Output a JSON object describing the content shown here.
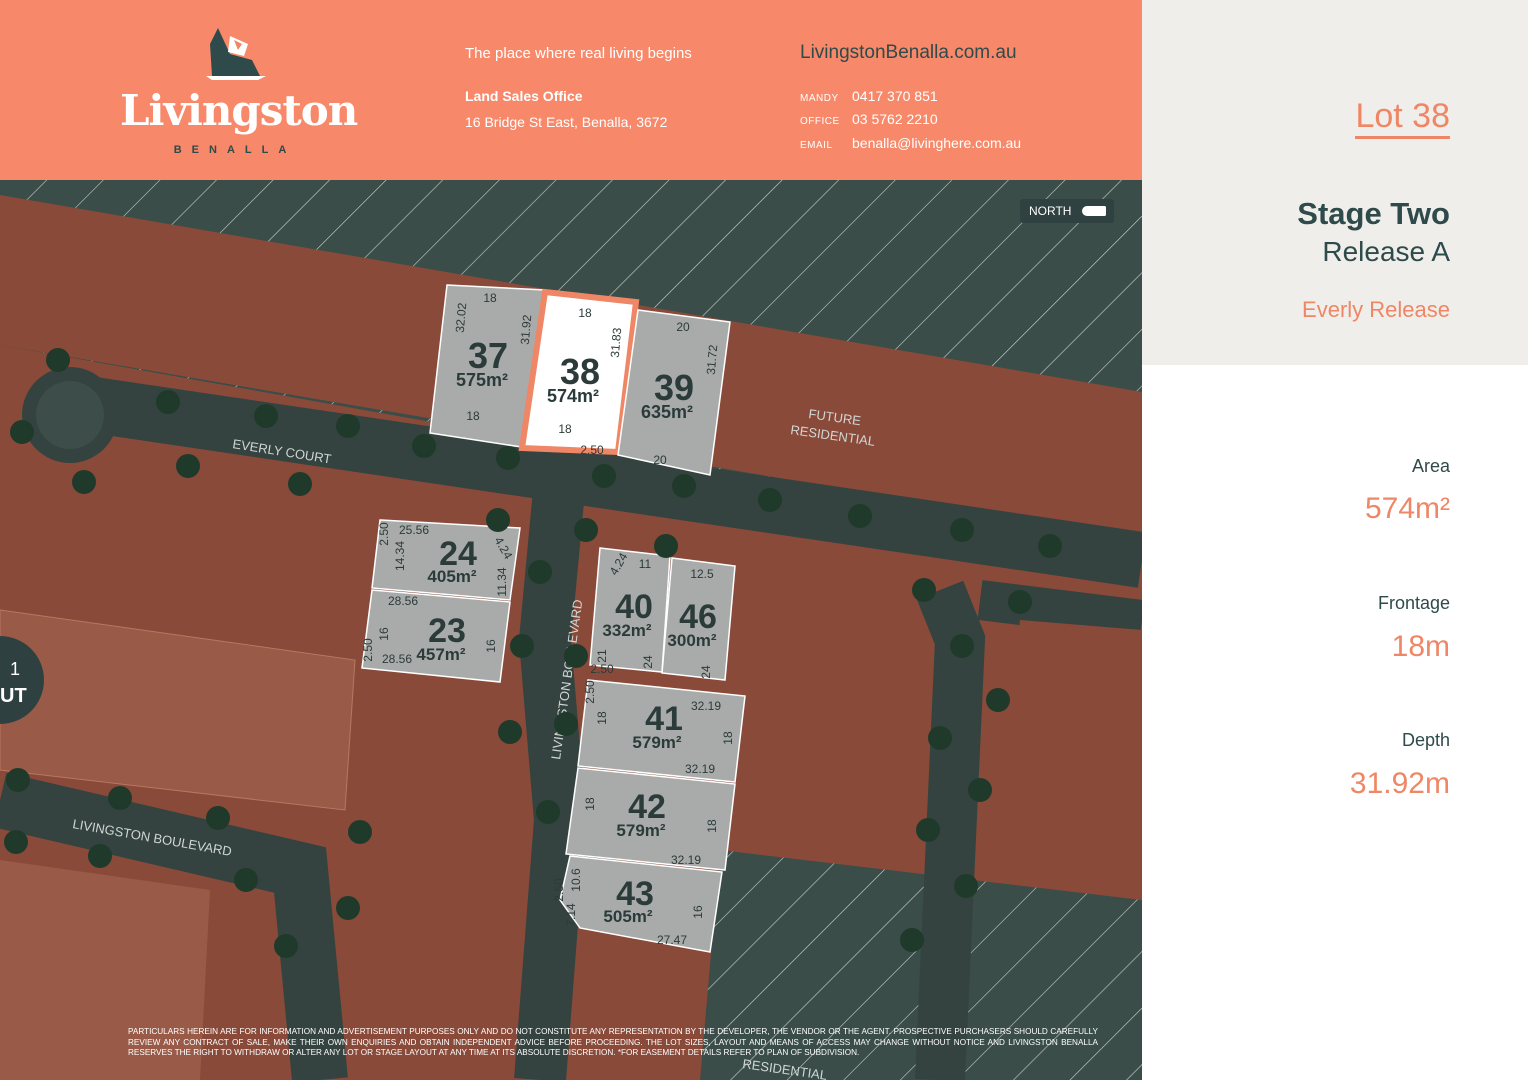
{
  "header": {
    "brand": "Livingston",
    "brand_sub": "BENALLA",
    "tagline": "The place where real living begins",
    "office_title": "Land Sales Office",
    "office_address": "16 Bridge St East, Benalla, 3672",
    "website": "LivingstonBenalla.com.au",
    "contacts": [
      {
        "key": "MANDY",
        "value": "0417 370 851"
      },
      {
        "key": "OFFICE",
        "value": "03 5762 2210"
      },
      {
        "key": "EMAIL",
        "value": "benalla@livinghere.com.au"
      }
    ],
    "colors": {
      "header_bg": "#f7896a",
      "accent": "#ef8665",
      "dark": "#2e4a4a"
    }
  },
  "map": {
    "north_label": "NORTH",
    "future_residential": [
      "FUTURE",
      "RESIDENTIAL"
    ],
    "bottom_residential": "RESIDENTIAL",
    "roads": {
      "everly": "EVERLY COURT",
      "livingston_v": "LIVINGSTON BOULEVARD",
      "livingston_h": "LIVINGSTON BOULEVARD"
    },
    "side_badge": [
      "1",
      "UT"
    ],
    "lots": [
      {
        "num": "37",
        "area": "575m²",
        "dims": [
          "18",
          "32.02",
          "31.92",
          "18"
        ]
      },
      {
        "num": "38",
        "area": "574m²",
        "dims": [
          "18",
          "31.83",
          "18",
          "2.50"
        ],
        "selected": true
      },
      {
        "num": "39",
        "area": "635m²",
        "dims": [
          "20",
          "31.72",
          "20"
        ]
      },
      {
        "num": "24",
        "area": "405m²",
        "dims": [
          "25.56",
          "2.50",
          "14.34",
          "4.24",
          "11.34"
        ]
      },
      {
        "num": "23",
        "area": "457m²",
        "dims": [
          "28.56",
          "2.50",
          "16",
          "16",
          "28.56"
        ]
      },
      {
        "num": "40",
        "area": "332m²",
        "dims": [
          "4.24",
          "11",
          "21",
          "24",
          "2.50"
        ]
      },
      {
        "num": "46",
        "area": "300m²",
        "dims": [
          "12.5",
          "24"
        ]
      },
      {
        "num": "41",
        "area": "579m²",
        "dims": [
          "32.19",
          "2.50",
          "18",
          "18",
          "32.19"
        ]
      },
      {
        "num": "42",
        "area": "579m²",
        "dims": [
          "18",
          "18",
          "32.19"
        ]
      },
      {
        "num": "43",
        "area": "505m²",
        "dims": [
          "10.6",
          "2.50",
          "7.14",
          "16",
          "27.47"
        ]
      }
    ],
    "disclaimer": "PARTICULARS HEREIN ARE FOR INFORMATION AND ADVERTISEMENT PURPOSES ONLY AND DO NOT CONSTITUTE ANY REPRESENTATION BY THE DEVELOPER, THE VENDOR OR THE AGENT. PROSPECTIVE PURCHASERS SHOULD CAREFULLY REVIEW ANY CONTRACT OF SALE, MAKE THEIR OWN ENQUIRIES AND OBTAIN INDEPENDENT ADVICE BEFORE PROCEEDING. THE LOT SIZES, LAYOUT AND MEANS OF ACCESS MAY CHANGE WITHOUT NOTICE AND LIVINGSTON BENALLA RESERVES THE RIGHT TO WITHDRAW OR ALTER ANY LOT OR STAGE LAYOUT AT ANY TIME AT ITS ABSOLUTE DISCRETION. *FOR EASEMENT DETAILS REFER TO PLAN OF SUBDIVISION."
  },
  "sidebar": {
    "lot_title": "Lot 38",
    "stage": "Stage Two",
    "release": "Release A",
    "release_name": "Everly Release",
    "specs": [
      {
        "label": "Area",
        "value": "574m²"
      },
      {
        "label": "Frontage",
        "value": "18m"
      },
      {
        "label": "Depth",
        "value": "31.92m"
      }
    ]
  }
}
